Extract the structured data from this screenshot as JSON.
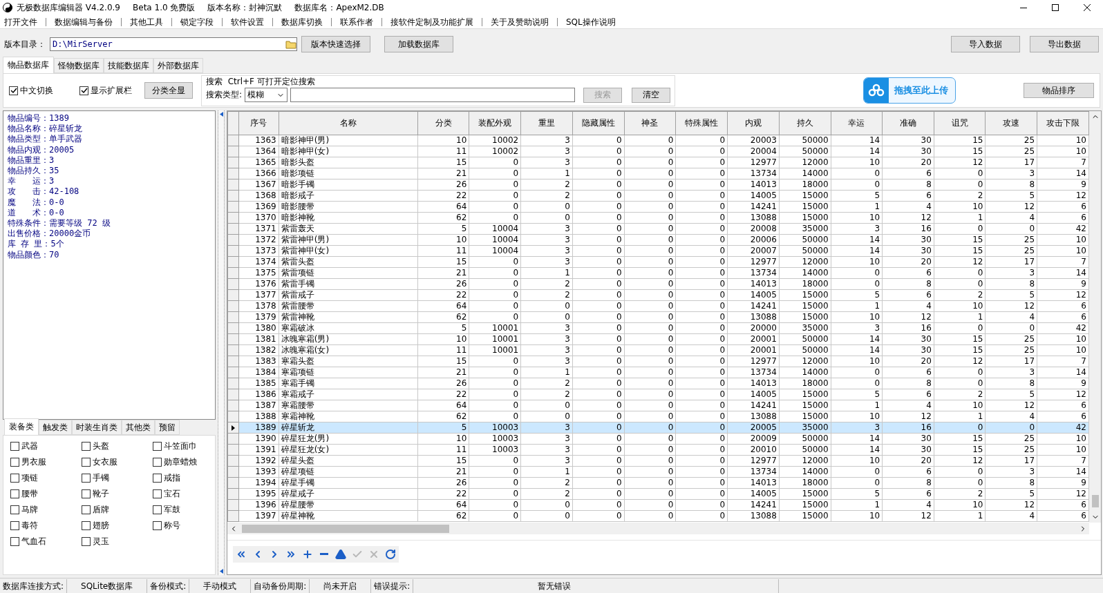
{
  "window": {
    "title": "无极数据库编辑器 V4.2.0.9",
    "edition": "Beta 1.0 免费版",
    "version_name": "版本名称：封神沉默",
    "database_name": "数据库名：ApexM2.DB"
  },
  "menu": [
    "打开文件",
    "数据编辑与备份",
    "其他工具",
    "锁定字段",
    "软件设置",
    "数据库切换",
    "联系作者",
    "接软件定制及功能扩展",
    "关于及赞助说明",
    "SQL操作说明"
  ],
  "toolbar": {
    "dir_label": "版本目录：",
    "dir_value": "D:\\MirServer",
    "buttons": [
      "版本快速选择",
      "加载数据库"
    ],
    "right_buttons": [
      "导入数据",
      "导出数据"
    ]
  },
  "tabs": [
    {
      "label": "物品数据库",
      "selected": true
    },
    {
      "label": "怪物数据库",
      "selected": false
    },
    {
      "label": "技能数据库",
      "selected": false
    },
    {
      "label": "外部数据库",
      "selected": false
    }
  ],
  "options": [
    {
      "label": "中文切换",
      "checked": true
    },
    {
      "label": "显示扩展栏",
      "checked": true
    }
  ],
  "show_all_button": "分类全显",
  "search": {
    "legend": "搜索  Ctrl+F 可打开定位搜索",
    "type_label": "搜索类型:",
    "type_value": "模糊",
    "search_button": {
      "label": "搜索",
      "disabled": true
    },
    "clear_button": "清空"
  },
  "upload_button": "拖拽至此上传",
  "sort_button": "物品排序",
  "details": [
    "物品编号：1389",
    "物品名称：碎星斩龙",
    "物品类型：单手武器",
    "物品内观：20005",
    "物品重里：3",
    "物品持久：35",
    "幸　　运：3",
    "攻　　击：42-108",
    "魔　　法：0-0",
    "道　　术：0-0",
    "特殊条件：需要等级 72 级",
    "出售价格：20000金币",
    "库 存 里：5个",
    "物品颜色：70"
  ],
  "category_tabs": [
    {
      "label": "装备类",
      "selected": true
    },
    {
      "label": "触发类",
      "selected": false
    },
    {
      "label": "时装生肖类",
      "selected": false
    },
    {
      "label": "其他类",
      "selected": false
    },
    {
      "label": "预留",
      "selected": false
    }
  ],
  "categories": [
    {
      "label": "武器",
      "checked": false
    },
    {
      "label": "头盔",
      "checked": false
    },
    {
      "label": "斗笠面巾",
      "checked": false
    },
    {
      "label": "男衣服",
      "checked": false
    },
    {
      "label": "女衣服",
      "checked": false
    },
    {
      "label": "勋章蜡烛",
      "checked": false
    },
    {
      "label": "项链",
      "checked": false
    },
    {
      "label": "手镯",
      "checked": false
    },
    {
      "label": "戒指",
      "checked": false
    },
    {
      "label": "腰带",
      "checked": false
    },
    {
      "label": "靴子",
      "checked": false
    },
    {
      "label": "宝石",
      "checked": false
    },
    {
      "label": "马牌",
      "checked": false
    },
    {
      "label": "盾牌",
      "checked": false
    },
    {
      "label": "军鼓",
      "checked": false
    },
    {
      "label": "毒符",
      "checked": false
    },
    {
      "label": "翅膀",
      "checked": false
    },
    {
      "label": "称号",
      "checked": false
    },
    {
      "label": "气血石",
      "checked": false
    },
    {
      "label": "灵玉",
      "checked": false
    }
  ],
  "table": {
    "columns": [
      "序号",
      "名称",
      "分类",
      "装配外观",
      "重里",
      "隐藏属性",
      "神圣",
      "特殊属性",
      "内观",
      "持久",
      "幸运",
      "准确",
      "诅咒",
      "攻速",
      "攻击下限"
    ],
    "rows": [
      {
        "selected": false,
        "cells": [
          "1363",
          "暗影神甲(男)",
          "10",
          "10002",
          "3",
          "0",
          "0",
          "0",
          "20003",
          "50000",
          "14",
          "30",
          "15",
          "25",
          "10"
        ]
      },
      {
        "selected": false,
        "cells": [
          "1364",
          "暗影神甲(女)",
          "11",
          "10002",
          "3",
          "0",
          "0",
          "0",
          "20004",
          "50000",
          "14",
          "30",
          "15",
          "25",
          "10"
        ]
      },
      {
        "selected": false,
        "cells": [
          "1365",
          "暗影头盔",
          "15",
          "0",
          "3",
          "0",
          "0",
          "0",
          "12977",
          "12000",
          "10",
          "20",
          "12",
          "17",
          "7"
        ]
      },
      {
        "selected": false,
        "cells": [
          "1366",
          "暗影项链",
          "21",
          "0",
          "1",
          "0",
          "0",
          "0",
          "13734",
          "14000",
          "0",
          "6",
          "0",
          "3",
          "14"
        ]
      },
      {
        "selected": false,
        "cells": [
          "1367",
          "暗影手镯",
          "26",
          "0",
          "2",
          "0",
          "0",
          "0",
          "14013",
          "18000",
          "0",
          "8",
          "0",
          "8",
          "9"
        ]
      },
      {
        "selected": false,
        "cells": [
          "1368",
          "暗影戒子",
          "22",
          "0",
          "2",
          "0",
          "0",
          "0",
          "14005",
          "15000",
          "5",
          "6",
          "2",
          "5",
          "12"
        ]
      },
      {
        "selected": false,
        "cells": [
          "1369",
          "暗影腰带",
          "64",
          "0",
          "0",
          "0",
          "0",
          "0",
          "14241",
          "15000",
          "1",
          "4",
          "10",
          "12",
          "6"
        ]
      },
      {
        "selected": false,
        "cells": [
          "1370",
          "暗影神靴",
          "62",
          "0",
          "0",
          "0",
          "0",
          "0",
          "13088",
          "15000",
          "10",
          "12",
          "1",
          "4",
          "6"
        ]
      },
      {
        "selected": false,
        "cells": [
          "1371",
          "紫雷轰天",
          "5",
          "10004",
          "3",
          "0",
          "0",
          "0",
          "20008",
          "35000",
          "3",
          "16",
          "0",
          "0",
          "42"
        ]
      },
      {
        "selected": false,
        "cells": [
          "1372",
          "紫雷神甲(男)",
          "10",
          "10004",
          "3",
          "0",
          "0",
          "0",
          "20006",
          "50000",
          "14",
          "30",
          "15",
          "25",
          "10"
        ]
      },
      {
        "selected": false,
        "cells": [
          "1373",
          "紫雷神甲(女)",
          "11",
          "10004",
          "3",
          "0",
          "0",
          "0",
          "20007",
          "50000",
          "14",
          "30",
          "15",
          "25",
          "10"
        ]
      },
      {
        "selected": false,
        "cells": [
          "1374",
          "紫雷头盔",
          "15",
          "0",
          "3",
          "0",
          "0",
          "0",
          "12977",
          "12000",
          "10",
          "20",
          "12",
          "17",
          "7"
        ]
      },
      {
        "selected": false,
        "cells": [
          "1375",
          "紫雷项链",
          "21",
          "0",
          "1",
          "0",
          "0",
          "0",
          "13734",
          "14000",
          "0",
          "6",
          "0",
          "3",
          "14"
        ]
      },
      {
        "selected": false,
        "cells": [
          "1376",
          "紫雷手镯",
          "26",
          "0",
          "2",
          "0",
          "0",
          "0",
          "14013",
          "18000",
          "0",
          "8",
          "0",
          "8",
          "9"
        ]
      },
      {
        "selected": false,
        "cells": [
          "1377",
          "紫雷戒子",
          "22",
          "0",
          "2",
          "0",
          "0",
          "0",
          "14005",
          "15000",
          "5",
          "6",
          "2",
          "5",
          "12"
        ]
      },
      {
        "selected": false,
        "cells": [
          "1378",
          "紫雷腰带",
          "64",
          "0",
          "0",
          "0",
          "0",
          "0",
          "14241",
          "15000",
          "1",
          "4",
          "10",
          "12",
          "6"
        ]
      },
      {
        "selected": false,
        "cells": [
          "1379",
          "紫雷神靴",
          "62",
          "0",
          "0",
          "0",
          "0",
          "0",
          "13088",
          "15000",
          "10",
          "12",
          "1",
          "4",
          "6"
        ]
      },
      {
        "selected": false,
        "cells": [
          "1380",
          "寒霜破冰",
          "5",
          "10001",
          "3",
          "0",
          "0",
          "0",
          "20000",
          "35000",
          "3",
          "16",
          "0",
          "0",
          "42"
        ]
      },
      {
        "selected": false,
        "cells": [
          "1381",
          "冰魄寒霜(男)",
          "10",
          "10001",
          "3",
          "0",
          "0",
          "0",
          "20001",
          "50000",
          "14",
          "30",
          "15",
          "25",
          "10"
        ]
      },
      {
        "selected": false,
        "cells": [
          "1382",
          "冰魄寒霜(女)",
          "11",
          "10001",
          "3",
          "0",
          "0",
          "0",
          "20001",
          "50000",
          "14",
          "30",
          "15",
          "25",
          "10"
        ]
      },
      {
        "selected": false,
        "cells": [
          "1383",
          "寒霜头盔",
          "15",
          "0",
          "3",
          "0",
          "0",
          "0",
          "12977",
          "12000",
          "10",
          "20",
          "12",
          "17",
          "7"
        ]
      },
      {
        "selected": false,
        "cells": [
          "1384",
          "寒霜项链",
          "21",
          "0",
          "1",
          "0",
          "0",
          "0",
          "13734",
          "14000",
          "0",
          "6",
          "0",
          "3",
          "14"
        ]
      },
      {
        "selected": false,
        "cells": [
          "1385",
          "寒霜手镯",
          "26",
          "0",
          "2",
          "0",
          "0",
          "0",
          "14013",
          "18000",
          "0",
          "8",
          "0",
          "8",
          "9"
        ]
      },
      {
        "selected": false,
        "cells": [
          "1386",
          "寒霜戒子",
          "22",
          "0",
          "2",
          "0",
          "0",
          "0",
          "14005",
          "15000",
          "5",
          "6",
          "2",
          "5",
          "12"
        ]
      },
      {
        "selected": false,
        "cells": [
          "1387",
          "寒霜腰带",
          "64",
          "0",
          "0",
          "0",
          "0",
          "0",
          "14241",
          "15000",
          "1",
          "4",
          "10",
          "12",
          "6"
        ]
      },
      {
        "selected": false,
        "cells": [
          "1388",
          "寒霜神靴",
          "62",
          "0",
          "0",
          "0",
          "0",
          "0",
          "13088",
          "15000",
          "10",
          "12",
          "1",
          "4",
          "6"
        ]
      },
      {
        "selected": true,
        "cells": [
          "1389",
          "碎星斩龙",
          "5",
          "10003",
          "3",
          "0",
          "0",
          "0",
          "20005",
          "35000",
          "3",
          "16",
          "0",
          "0",
          "42"
        ]
      },
      {
        "selected": false,
        "cells": [
          "1390",
          "碎星狂龙(男)",
          "10",
          "10003",
          "3",
          "0",
          "0",
          "0",
          "20009",
          "50000",
          "14",
          "30",
          "15",
          "25",
          "10"
        ]
      },
      {
        "selected": false,
        "cells": [
          "1391",
          "碎星狂龙(女)",
          "11",
          "10003",
          "3",
          "0",
          "0",
          "0",
          "20010",
          "50000",
          "14",
          "30",
          "15",
          "25",
          "10"
        ]
      },
      {
        "selected": false,
        "cells": [
          "1392",
          "碎星头盔",
          "15",
          "0",
          "3",
          "0",
          "0",
          "0",
          "12977",
          "12000",
          "10",
          "20",
          "12",
          "17",
          "7"
        ]
      },
      {
        "selected": false,
        "cells": [
          "1393",
          "碎星项链",
          "21",
          "0",
          "1",
          "0",
          "0",
          "0",
          "13734",
          "14000",
          "0",
          "6",
          "0",
          "3",
          "14"
        ]
      },
      {
        "selected": false,
        "cells": [
          "1394",
          "碎星手镯",
          "26",
          "0",
          "2",
          "0",
          "0",
          "0",
          "14013",
          "18000",
          "0",
          "8",
          "0",
          "8",
          "9"
        ]
      },
      {
        "selected": false,
        "cells": [
          "1395",
          "碎星戒子",
          "22",
          "0",
          "2",
          "0",
          "0",
          "0",
          "14005",
          "15000",
          "5",
          "6",
          "2",
          "5",
          "12"
        ]
      },
      {
        "selected": false,
        "cells": [
          "1396",
          "碎星腰带",
          "64",
          "0",
          "0",
          "0",
          "0",
          "0",
          "14241",
          "15000",
          "1",
          "4",
          "10",
          "12",
          "6"
        ]
      },
      {
        "selected": false,
        "cells": [
          "1397",
          "碎星神靴",
          "62",
          "0",
          "0",
          "0",
          "0",
          "0",
          "13088",
          "15000",
          "10",
          "12",
          "1",
          "4",
          "6"
        ]
      }
    ]
  },
  "nav_buttons": [
    {
      "kind": "first",
      "disabled": false
    },
    {
      "kind": "prior",
      "disabled": false
    },
    {
      "kind": "next",
      "disabled": false
    },
    {
      "kind": "last",
      "disabled": false
    },
    {
      "kind": "insert",
      "disabled": false
    },
    {
      "kind": "delete",
      "disabled": false
    },
    {
      "kind": "edit",
      "disabled": false
    },
    {
      "kind": "post",
      "disabled": true
    },
    {
      "kind": "cancel",
      "disabled": true
    },
    {
      "kind": "refresh",
      "disabled": false
    }
  ],
  "status_bar": [
    "数据库连接方式:",
    "SQLite数据库",
    "备份模式:",
    "手动模式",
    "自动备份周期:",
    "尚未开启",
    "错误提示:",
    "暂无错误"
  ]
}
